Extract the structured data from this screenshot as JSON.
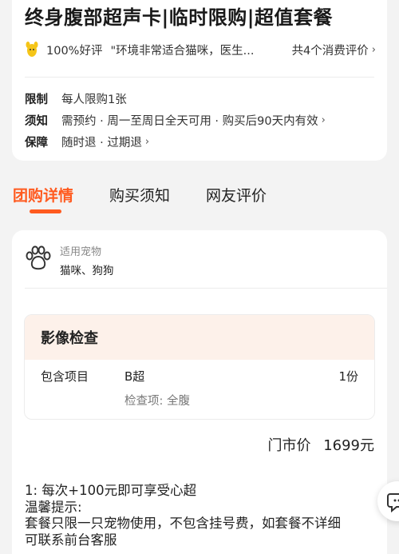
{
  "product": {
    "title": "终身腹部超声卡|临时限购|超值套餐"
  },
  "review": {
    "rate": "100%好评",
    "quote": "\"环境非常适合猫咪，医生...",
    "count": "共4个消费评价",
    "chevron": "›"
  },
  "info": [
    {
      "key": "限制",
      "value": "每人限购1张",
      "has_chevron": false
    },
    {
      "key": "须知",
      "value": "需预约 · 周一至周日全天可用 · 购买后90天内有效",
      "has_chevron": true
    },
    {
      "key": "保障",
      "value": "随时退 · 过期退",
      "has_chevron": true
    }
  ],
  "tabs": [
    {
      "label": "团购详情",
      "active": true
    },
    {
      "label": "购买须知",
      "active": false
    },
    {
      "label": "网友评价",
      "active": false
    }
  ],
  "pet": {
    "label": "适用宠物",
    "value": "猫咪、狗狗",
    "icon": "paw-icon"
  },
  "package": {
    "section_title": "影像检查",
    "item_label": "包含项目",
    "item_name": "B超",
    "item_qty": "1份",
    "item_detail": "检查项: 全腹"
  },
  "price": {
    "label": "门市价",
    "value": "1699元"
  },
  "notes": {
    "line1": "1: 每次+100元即可享受心超",
    "line2": "温馨提示:",
    "line3": "套餐只限一只宠物使用，不包含挂号费，如套餐不详细",
    "line4": "可联系前台客服"
  },
  "colors": {
    "accent": "#ff5a1f",
    "section_bg": "#fdf1ea",
    "rating_icon": "#f5c518"
  }
}
